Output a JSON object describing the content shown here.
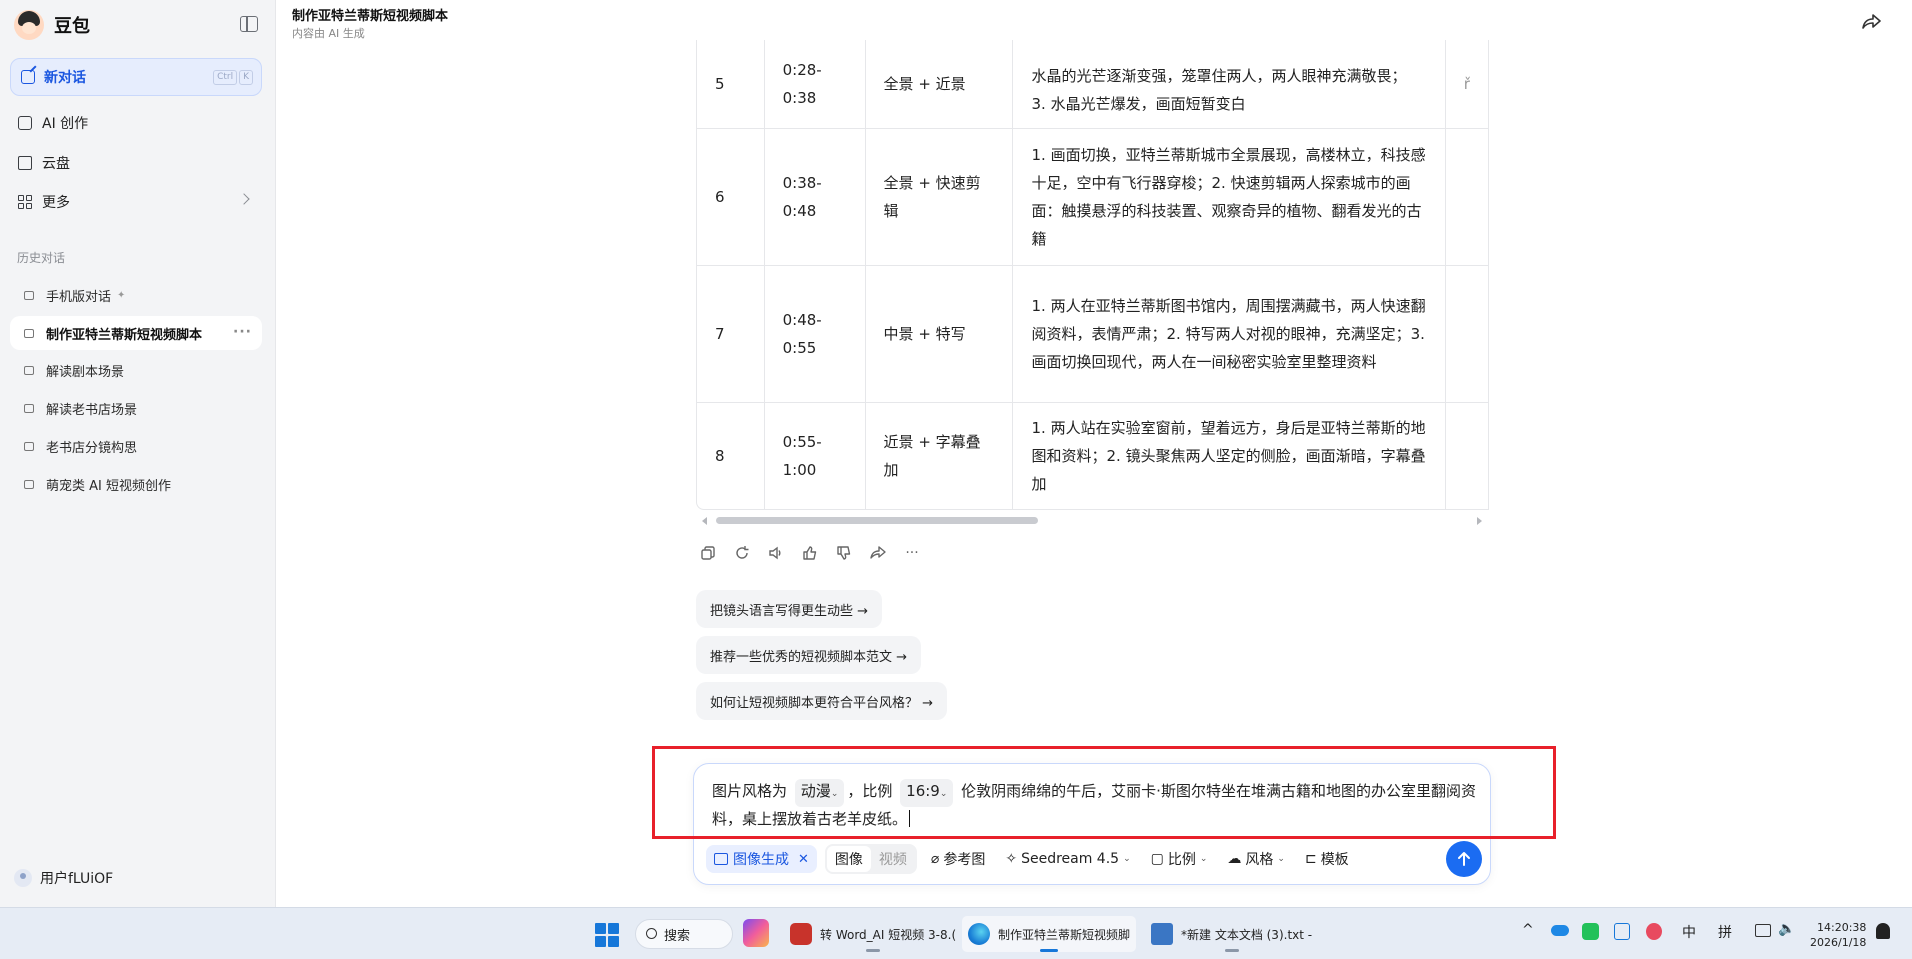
{
  "app": {
    "name": "豆包"
  },
  "sidebar": {
    "new_chat": {
      "label": "新对话",
      "shortcut": [
        "Ctrl",
        "K"
      ]
    },
    "nav": [
      {
        "label": "AI 创作",
        "icon": "ai-create-icon"
      },
      {
        "label": "云盘",
        "icon": "cloud-drive-icon"
      },
      {
        "label": "更多",
        "icon": "grid-icon"
      }
    ],
    "history_title": "历史对话",
    "history": [
      {
        "label": "手机版对话",
        "pinned": true
      },
      {
        "label": "制作亚特兰蒂斯短视频脚本",
        "active": true
      },
      {
        "label": "解读剧本场景"
      },
      {
        "label": "解读老书店场景"
      },
      {
        "label": "老书店分镜构思"
      },
      {
        "label": "萌宠类 AI 短视频创作"
      }
    ],
    "user": "用户fLUiOF"
  },
  "header": {
    "title": "制作亚特兰蒂斯短视频脚本",
    "subtitle": "内容由 AI 生成"
  },
  "table": {
    "rows": [
      {
        "no": "5",
        "time": "0:28-0:38",
        "shot": "全景 + 近景",
        "desc_lines": [
          "水晶的光芒逐渐变强，笼罩住两人，两人眼神充满敬畏；",
          "3. 水晶光芒爆发，画面短暂变白"
        ],
        "extra": "ř"
      },
      {
        "no": "6",
        "time": "0:38-0:48",
        "shot": "全景 + 快速剪辑",
        "desc": "1. 画面切换，亚特兰蒂斯城市全景展现，高楼林立，科技感十足，空中有飞行器穿梭；2. 快速剪辑两人探索城市的画面：触摸悬浮的科技装置、观察奇异的植物、翻看发光的古籍",
        "extra": ""
      },
      {
        "no": "7",
        "time": "0:48-0:55",
        "shot": "中景 + 特写",
        "desc": "1. 两人在亚特兰蒂斯图书馆内，周围摆满藏书，两人快速翻阅资料，表情严肃；2. 特写两人对视的眼神，充满坚定；3. 画面切换回现代，两人在一间秘密实验室里整理资料",
        "extra": ""
      },
      {
        "no": "8",
        "time": "0:55-1:00",
        "shot": "近景 + 字幕叠加",
        "desc": "1. 两人站在实验室窗前，望着远方，身后是亚特兰蒂斯的地图和资料；2. 镜头聚焦两人坚定的侧脸，画面渐暗，字幕叠加",
        "extra": ""
      }
    ]
  },
  "actions": [
    "copy-icon",
    "regenerate-icon",
    "speaker-icon",
    "thumbs-up-icon",
    "thumbs-down-icon",
    "share-icon",
    "more-icon"
  ],
  "suggestions": [
    "把镜头语言写得更生动些 →",
    "推荐一些优秀的短视频脚本范文 →",
    "如何让短视频脚本更符合平台风格？ →"
  ],
  "input": {
    "prefix": "图片风格为",
    "style_chip": "动漫",
    "mid": "，比例",
    "ratio_chip": "16:9",
    "text": "伦敦阴雨绵绵的午后，艾丽卡·斯图尔特坐在堆满古籍和地图的办公室里翻阅资料，桌上摆放着古老羊皮纸。"
  },
  "toolbar": {
    "mode": "图像生成",
    "seg_image": "图像",
    "seg_video": "视频",
    "reference": "参考图",
    "model": "Seedream 4.5",
    "ratio": "比例",
    "style": "风格",
    "template": "模板"
  },
  "taskbar": {
    "search": "搜索",
    "apps": [
      {
        "label": "转 Word_AI 短视频 3-8.(",
        "color": "#c8332b"
      },
      {
        "label": "制作亚特兰蒂斯短视频脚",
        "color": "#1a7fd6"
      },
      {
        "label": "*新建 文本文档 (3).txt - ",
        "color": "#3a76c4"
      }
    ],
    "ime_lang": "中",
    "ime_mode": "拼",
    "time": "14:20:38",
    "date": "2026/1/18"
  }
}
